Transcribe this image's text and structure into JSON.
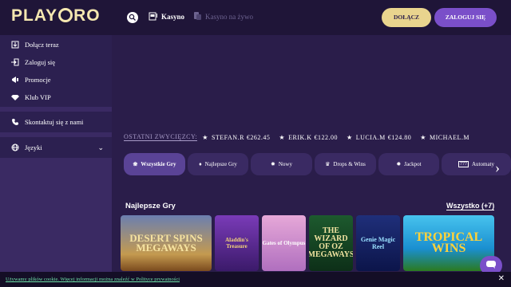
{
  "header": {
    "logo": "PLAYORO",
    "nav_casino": "Kasyno",
    "nav_live": "Kasyno na żywo",
    "join_label": "DOŁĄCZ",
    "login_label": "ZALOGUJ SIĘ"
  },
  "sidebar": {
    "items": [
      {
        "label": "Dołącz teraz",
        "icon": "join-icon"
      },
      {
        "label": "Zaloguj się",
        "icon": "login-icon"
      },
      {
        "label": "Promocje",
        "icon": "megaphone-icon"
      },
      {
        "label": "Klub VIP",
        "icon": "diamond-icon"
      }
    ],
    "contact": "Skontaktuj się z nami",
    "languages": "Języki"
  },
  "winners": {
    "label": "OSTATNI ZWYCIĘZCY:",
    "list": [
      {
        "name": "STEFAN.R",
        "amount": "€262.45"
      },
      {
        "name": "ERIK.K",
        "amount": "€122.00"
      },
      {
        "name": "LUCIA.M",
        "amount": "€124.80"
      },
      {
        "name": "MICHAEL.M",
        "amount": ""
      }
    ]
  },
  "categories": [
    {
      "label": "Wszystkie Gry",
      "icon": "all-games-icon",
      "active": true
    },
    {
      "label": "Najlepsze Gry",
      "icon": "gem-icon",
      "active": false
    },
    {
      "label": "Nowy",
      "icon": "new-icon",
      "active": false
    },
    {
      "label": "Drops & Wins",
      "icon": "crown-icon",
      "active": false
    },
    {
      "label": "Jackpot",
      "icon": "jackpot-icon",
      "active": false
    },
    {
      "label": "Automaty",
      "icon": "slot-777-icon",
      "active": false
    }
  ],
  "section": {
    "title": "Najlepsze Gry",
    "all_link": "Wszystko (+7)"
  },
  "games": [
    {
      "title": "DESERT SPINS MEGAWAYS"
    },
    {
      "title": "Aladdin's Treasure"
    },
    {
      "title": "Gates of Olympus"
    },
    {
      "title": "THE WIZARD OF OZ MEGAWAYS"
    },
    {
      "title": "Genie Magic Reel"
    },
    {
      "title": "TROPICAL WINS"
    }
  ],
  "cookie": {
    "text": "Używamy plików cookie. Więcej informacji można znaleźć w Polityce prywatności"
  },
  "colors": {
    "accent_gold": "#e9d48e",
    "accent_purple": "#7a4fc9",
    "background": "#2a1d4a",
    "cookie_link": "#6ee0a8"
  }
}
